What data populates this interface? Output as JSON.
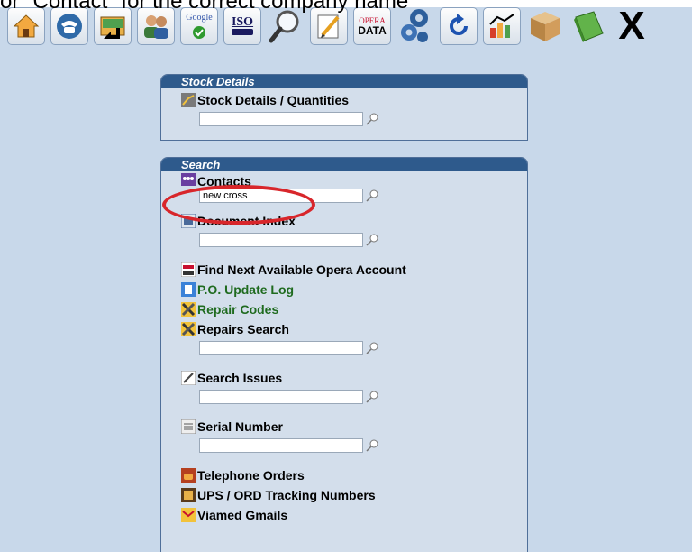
{
  "caption": "or \"Contact\" for the correct company name",
  "toolbar": {
    "buttons": [
      {
        "icon": "home-icon"
      },
      {
        "icon": "telephone-icon"
      },
      {
        "icon": "shortcut-icon"
      },
      {
        "icon": "users-icon"
      },
      {
        "icon": "google-icon",
        "text": "Google"
      },
      {
        "icon": "iso-icon",
        "text": "ISO"
      },
      {
        "icon": "magnifier-icon"
      },
      {
        "icon": "edit-icon"
      },
      {
        "icon": "opera-data-icon",
        "text_top": "OPERA",
        "text_bottom": "DATA"
      },
      {
        "icon": "gears-icon"
      },
      {
        "icon": "refresh-icon"
      },
      {
        "icon": "chart-icon"
      },
      {
        "icon": "package-icon"
      },
      {
        "icon": "book-icon"
      },
      {
        "icon": "close-icon",
        "text": "X"
      }
    ]
  },
  "stock_panel": {
    "title": "Stock Details",
    "item_label": "Stock Details / Quantities",
    "input_value": ""
  },
  "search_panel": {
    "title": "Search",
    "contacts_label": "Contacts",
    "contacts_value": "new cross",
    "document_index_label": "Document Index",
    "document_index_value": "",
    "opera_account_label": "Find Next Available Opera Account",
    "po_log_label": "P.O. Update Log",
    "repair_codes_label": "Repair Codes",
    "repairs_search_label": "Repairs Search",
    "repairs_search_value": "",
    "search_issues_label": "Search Issues",
    "search_issues_value": "",
    "serial_number_label": "Serial Number",
    "serial_number_value": "",
    "telephone_orders_label": "Telephone Orders",
    "ups_label": "UPS / ORD Tracking Numbers",
    "gmails_label": "Viamed Gmails"
  },
  "colors": {
    "panel_header": "#2e5a8c",
    "background": "#c8d8ea",
    "highlight_ring": "#d8262b",
    "link_green": "#1f6b1f"
  }
}
